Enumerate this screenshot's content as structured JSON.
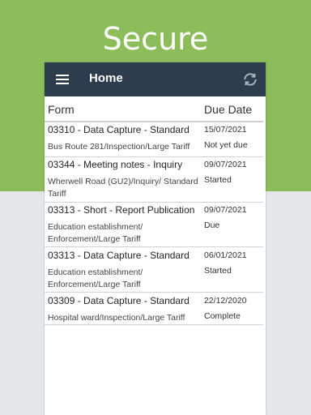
{
  "hero": {
    "title": "Secure"
  },
  "app_bar": {
    "title": "Home",
    "menu_icon": "hamburger-menu-icon",
    "refresh_icon": "refresh-icon",
    "color": "#2e3d4d"
  },
  "table": {
    "columns": [
      "Form",
      "Due Date"
    ],
    "rows": [
      {
        "title": "03310 - Data Capture - Standard",
        "subtitle": "Bus Route 281/Inspection/Large Tariff",
        "due_date": "15/07/2021",
        "status": "Not yet due"
      },
      {
        "title": "03344 - Meeting notes - Inquiry",
        "subtitle": "Wherwell Road (GU2)/Inquiry/ Standard Tariff",
        "due_date": "09/07/2021",
        "status": "Started"
      },
      {
        "title": "03313 - Short - Report Publication",
        "subtitle": "Education establishment/ Enforcement/Large Tariff",
        "due_date": "09/07/2021",
        "status": "Due"
      },
      {
        "title": "03313 - Data Capture - Standard",
        "subtitle": "Education establishment/ Enforcement/Large Tariff",
        "due_date": "06/01/2021",
        "status": "Started"
      },
      {
        "title": "03309 - Data Capture - Standard",
        "subtitle": "Hospital ward/Inspection/Large Tariff",
        "due_date": "22/12/2020",
        "status": "Complete"
      }
    ]
  },
  "colors": {
    "background_green": "#8cbd5a",
    "background_grey": "#e3e7ea"
  }
}
